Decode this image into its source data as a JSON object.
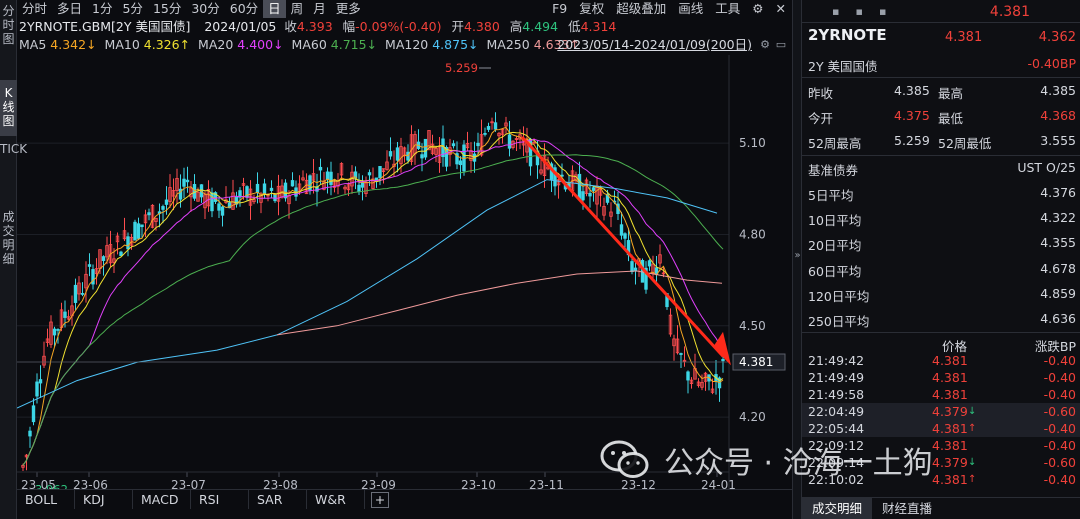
{
  "vtabs": [
    "分时图",
    "K线图",
    "TICK",
    "成交明细"
  ],
  "periods": [
    "分时",
    "多日",
    "1分",
    "5分",
    "15分",
    "30分",
    "60分",
    "日",
    "周",
    "月",
    "更多"
  ],
  "active_period": "日",
  "topbar_right": [
    "F9",
    "复权",
    "超级叠加",
    "画线",
    "工具"
  ],
  "info": {
    "symbol": "2YRNOTE.GBM[2Y 美国国债]",
    "date": "2024/01/05",
    "close_label": "收",
    "close": "4.393",
    "chg_label": "幅",
    "chg": "-0.09%(-0.40)",
    "open_label": "开",
    "open": "4.380",
    "high_label": "高",
    "high": "4.494",
    "low_label": "低",
    "low": "4.314"
  },
  "ma": [
    {
      "label": "MA5",
      "value": "4.342",
      "color": "#f5a623"
    },
    {
      "label": "MA10",
      "value": "4.326",
      "color": "#f0e130"
    },
    {
      "label": "MA20",
      "value": "4.400",
      "color": "#e040fb"
    },
    {
      "label": "MA60",
      "value": "4.715",
      "color": "#4caf50"
    },
    {
      "label": "MA120",
      "value": "4.875",
      "color": "#4fc3f7"
    },
    {
      "label": "MA250",
      "value": "4.633",
      "color": "#ef9a9a"
    }
  ],
  "ma_arrows": [
    "↓",
    "↑",
    "↓",
    "↓",
    "↓",
    "↑"
  ],
  "range": "2023/05/14-2024/01/09(200日)",
  "chart_data": {
    "type": "candlestick",
    "y_ticks": [
      "5.10",
      "4.80",
      "4.50",
      "4.20"
    ],
    "ylim": [
      4.0,
      5.35
    ],
    "x_ticks": [
      "23-05",
      "23-06",
      "23-07",
      "23-08",
      "23-09",
      "23-10",
      "23-11",
      "23-12",
      "24-01"
    ],
    "max_label": "5.259",
    "min_label": "3.962",
    "last_price": "4.381",
    "gridlines": true
  },
  "indicators": [
    "BOLL",
    "KDJ",
    "MACD",
    "RSI",
    "SAR",
    "W&R"
  ],
  "panel": {
    "big_price": "4.381",
    "symbol": "2YRNOTE",
    "price1": "4.381",
    "price2": "4.362",
    "name": "2Y 美国国债",
    "bp": "-0.40BP",
    "quotes": [
      {
        "l1": "昨收",
        "v1": "4.385",
        "c1": "#d4d7de",
        "l2": "最高",
        "v2": "4.385",
        "c2": "#d4d7de"
      },
      {
        "l1": "今开",
        "v1": "4.375",
        "c1": "#f0413a",
        "l2": "最低",
        "v2": "4.368",
        "c2": "#f0413a"
      },
      {
        "l1": "52周最高",
        "v1": "5.259",
        "c1": "#d4d7de",
        "l2": "52周最低",
        "v2": "3.555",
        "c2": "#d4d7de"
      }
    ],
    "bench_label": "基准债券",
    "bench_value": "UST O/25",
    "avgs": [
      {
        "label": "5日平均",
        "value": "4.376"
      },
      {
        "label": "10日平均",
        "value": "4.322"
      },
      {
        "label": "20日平均",
        "value": "4.355"
      },
      {
        "label": "60日平均",
        "value": "4.678"
      },
      {
        "label": "120日平均",
        "value": "4.859"
      },
      {
        "label": "250日平均",
        "value": "4.636"
      }
    ],
    "col_price": "价格",
    "col_bp": "涨跌BP",
    "trades": [
      {
        "t": "21:49:42",
        "p": "4.381",
        "d": "",
        "bp": "-0.40",
        "pc": "#f0413a"
      },
      {
        "t": "21:49:49",
        "p": "4.381",
        "d": "",
        "bp": "-0.40",
        "pc": "#f0413a"
      },
      {
        "t": "21:49:58",
        "p": "4.381",
        "d": "",
        "bp": "-0.40",
        "pc": "#f0413a"
      },
      {
        "t": "22:04:49",
        "p": "4.379",
        "d": "↓",
        "bp": "-0.60",
        "pc": "#f0413a"
      },
      {
        "t": "22:05:44",
        "p": "4.381",
        "d": "↑",
        "bp": "-0.40",
        "pc": "#f0413a"
      },
      {
        "t": "22:09:12",
        "p": "4.381",
        "d": "",
        "bp": "-0.40",
        "pc": "#f0413a"
      },
      {
        "t": "22:09:14",
        "p": "4.379",
        "d": "↓",
        "bp": "-0.60",
        "pc": "#f0413a"
      },
      {
        "t": "22:10:02",
        "p": "4.381",
        "d": "↑",
        "bp": "-0.40",
        "pc": "#f0413a"
      }
    ],
    "tabs": [
      "成交明细",
      "财经直播"
    ]
  },
  "watermark": "公众号 · 沧海一土狗"
}
